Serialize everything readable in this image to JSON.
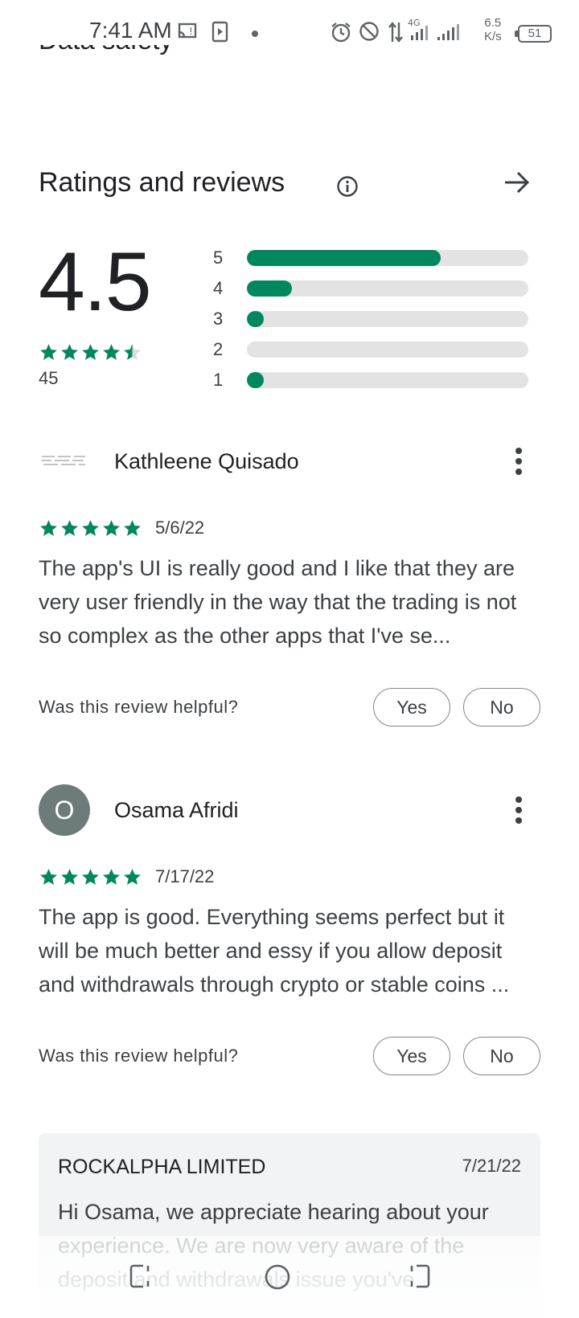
{
  "status_bar": {
    "time": "7:41 AM",
    "speed_value": "6.5",
    "speed_unit": "K/s",
    "network": "4G",
    "battery": "51"
  },
  "cut_heading": "Data safety",
  "section": {
    "title": "Ratings and reviews"
  },
  "summary": {
    "score": "4.5",
    "stars": 4.5,
    "count": "45",
    "distribution": [
      {
        "label": "5",
        "fraction": 0.69
      },
      {
        "label": "4",
        "fraction": 0.16
      },
      {
        "label": "3",
        "fraction": 0.06
      },
      {
        "label": "2",
        "fraction": 0.0
      },
      {
        "label": "1",
        "fraction": 0.06
      }
    ]
  },
  "reviews": [
    {
      "name": "Kathleene Quisado",
      "avatar_letter": "",
      "stars": 5,
      "date": "5/6/22",
      "text": "The app's UI is really good and I like that they are very user friendly in the way that the trading is not so complex as the other apps that I've se...",
      "helpful_question": "Was this review helpful?",
      "yes_label": "Yes",
      "no_label": "No"
    },
    {
      "name": "Osama Afridi",
      "avatar_letter": "O",
      "stars": 5,
      "date": "7/17/22",
      "text": "The app is good. Everything seems perfect but it will be much better and essy if you allow deposit and withdrawals through crypto or stable coins ...",
      "helpful_question": "Was this review helpful?",
      "yes_label": "Yes",
      "no_label": "No"
    }
  ],
  "developer_reply": {
    "developer": "ROCKALPHA LIMITED",
    "date": "7/21/22",
    "text": "Hi Osama, we appreciate hearing about your experience. We are now very aware of the deposit and withdrawals issue you've"
  },
  "colors": {
    "accent": "#01875f",
    "track": "#e3e3e3",
    "avatar": "#6e7b7b",
    "reply_bg": "#f1f3f4"
  }
}
